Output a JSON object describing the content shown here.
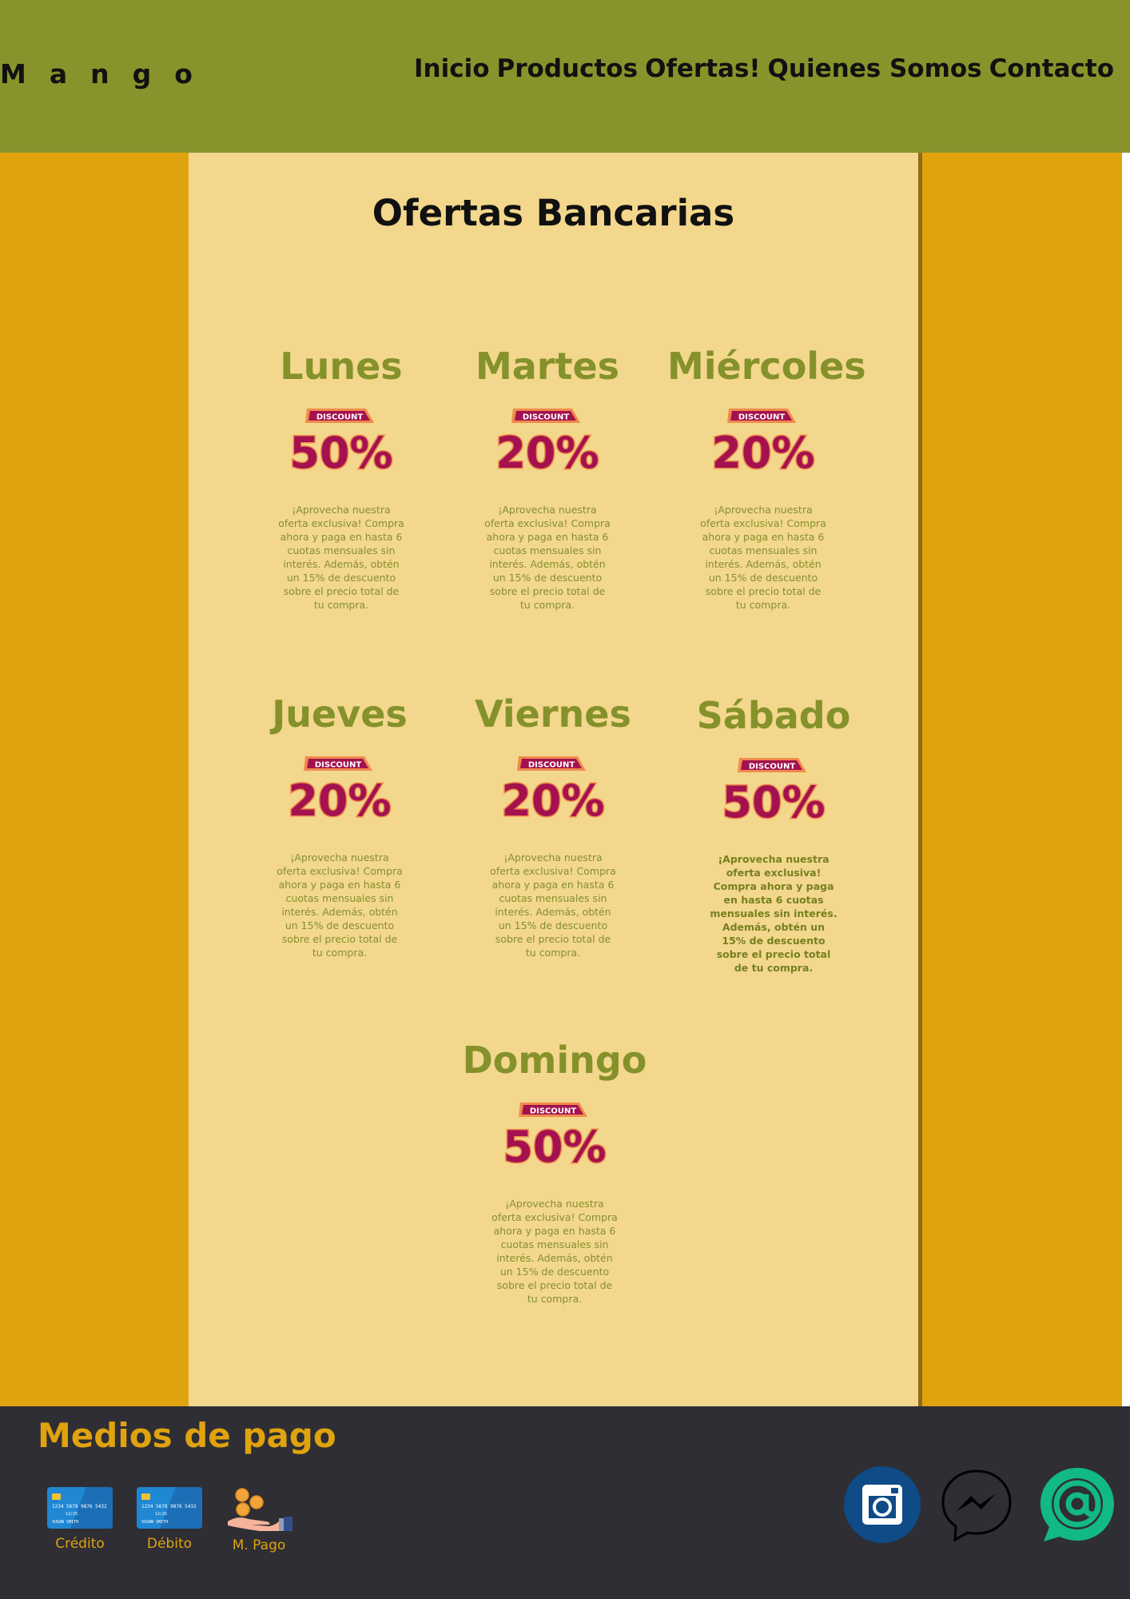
{
  "header": {
    "brand": "Mango",
    "nav": [
      "Inicio",
      "Productos",
      "Ofertas!",
      "Quienes Somos",
      "Contacto"
    ]
  },
  "main": {
    "title": "Ofertas Bancarias",
    "days": [
      {
        "name": "Lunes",
        "badge_label": "DISCOUNT",
        "discount": "50%",
        "text": "¡Aprovecha nuestra oferta exclusiva! Compra ahora y paga en hasta 6 cuotas mensuales sin interés. Además, obtén un 15% de descuento sobre el precio total de tu compra."
      },
      {
        "name": "Martes",
        "badge_label": "DISCOUNT",
        "discount": "20%",
        "text": "¡Aprovecha nuestra oferta exclusiva! Compra ahora y paga en hasta 6 cuotas mensuales sin interés. Además, obtén un 15% de descuento sobre el precio total de tu compra."
      },
      {
        "name": "Miércoles",
        "badge_label": "DISCOUNT",
        "discount": "20%",
        "text": "¡Aprovecha nuestra oferta exclusiva! Compra ahora y paga en hasta 6 cuotas mensuales sin interés. Además, obtén un 15% de descuento sobre el precio total de tu compra."
      },
      {
        "name": "Jueves",
        "badge_label": "DISCOUNT",
        "discount": "20%",
        "text": "¡Aprovecha nuestra oferta exclusiva! Compra ahora y paga en hasta 6 cuotas mensuales sin interés. Además, obtén un 15% de descuento sobre el precio total de tu compra."
      },
      {
        "name": "Viernes",
        "badge_label": "DISCOUNT",
        "discount": "20%",
        "text": "¡Aprovecha nuestra oferta exclusiva! Compra ahora y paga en hasta 6 cuotas mensuales sin interés. Además, obtén un 15% de descuento sobre el precio total de tu compra."
      },
      {
        "name": "Sábado",
        "badge_label": "DISCOUNT",
        "discount": "50%",
        "text": "¡Aprovecha nuestra oferta exclusiva! Compra ahora y paga en hasta 6 cuotas mensuales sin interés. Además, obtén un 15% de descuento sobre el precio total de tu compra."
      },
      {
        "name": "Domingo",
        "badge_label": "DISCOUNT",
        "discount": "50%",
        "text": "¡Aprovecha nuestra oferta exclusiva! Compra ahora y paga en hasta 6 cuotas mensuales sin interés. Además, obtén un 15% de descuento sobre el precio total de tu compra."
      }
    ]
  },
  "footer": {
    "title": "Medios de pago",
    "methods": [
      {
        "label": "Crédito",
        "icon": "credit-card-icon",
        "card_number": "1234 5678 9876 5432",
        "card_expiry": "12/25",
        "card_holder": "SUSAN SMITH"
      },
      {
        "label": "Débito",
        "icon": "debit-card-icon",
        "card_number": "1234 5678 9876 5432",
        "card_expiry": "12/25",
        "card_holder": "SUSAN SMITH"
      },
      {
        "label": "M. Pago",
        "icon": "coins-hand-icon"
      }
    ],
    "social": [
      "instagram-icon",
      "messenger-icon",
      "email-at-icon"
    ]
  },
  "colors": {
    "header": "#88942b",
    "accent": "#e0a30e",
    "content": "#f2d78c",
    "day_heading": "#85912a",
    "footer": "#2e2e34",
    "badge_primary": "#a3124f",
    "badge_outline": "#f08a4b"
  }
}
